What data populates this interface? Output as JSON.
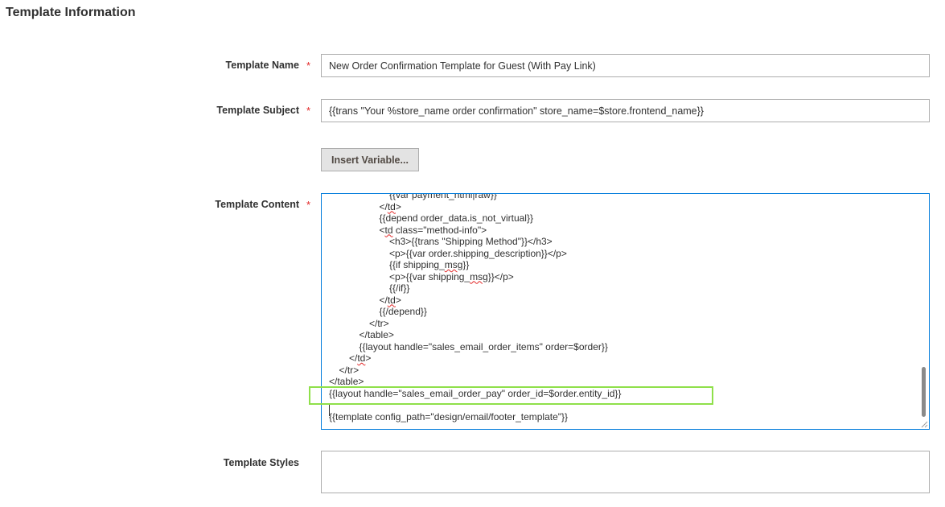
{
  "section": {
    "title": "Template Information"
  },
  "required_marker": "*",
  "fields": {
    "template_name": {
      "label": "Template Name",
      "value": "New Order Confirmation Template for Guest (With Pay Link)"
    },
    "template_subject": {
      "label": "Template Subject",
      "value": "{{trans \"Your %store_name order confirmation\" store_name=$store.frontend_name}}"
    },
    "insert_variable": {
      "label": "Insert Variable..."
    },
    "template_content": {
      "label": "Template Content",
      "lines": [
        {
          "text": "{{var payment_html|raw}}",
          "indent": 6
        },
        {
          "text": "</td>",
          "indent": 5,
          "spell": "td"
        },
        {
          "text": "{{depend order_data.is_not_virtual}}",
          "indent": 5
        },
        {
          "text": "<td class=\"method-info\">",
          "indent": 5,
          "spell": "td"
        },
        {
          "text": "<h3>{{trans \"Shipping Method\"}}</h3>",
          "indent": 6
        },
        {
          "text": "<p>{{var order.shipping_description}}</p>",
          "indent": 6
        },
        {
          "text": "{{if shipping_msg}}",
          "indent": 6,
          "spell": "msg"
        },
        {
          "text": "<p>{{var shipping_msg}}</p>",
          "indent": 6,
          "spell": "msg"
        },
        {
          "text": "{{/if}}",
          "indent": 6
        },
        {
          "text": "</td>",
          "indent": 5,
          "spell": "td"
        },
        {
          "text": "{{/depend}}",
          "indent": 5
        },
        {
          "text": "</tr>",
          "indent": 4
        },
        {
          "text": "</table>",
          "indent": 3
        },
        {
          "text": "{{layout handle=\"sales_email_order_items\" order=$order}}",
          "indent": 3
        },
        {
          "text": "</td>",
          "indent": 2,
          "spell": "td"
        },
        {
          "text": "</tr>",
          "indent": 1
        },
        {
          "text": "</table>",
          "indent": 0
        },
        {
          "text": "{{layout handle=\"sales_email_order_pay\" order_id=$order.entity_id}}",
          "indent": 0
        },
        {
          "text": "",
          "indent": 0
        },
        {
          "text": "{{template config_path=\"design/email/footer_template\"}}",
          "indent": 0
        }
      ]
    },
    "template_styles": {
      "label": "Template Styles",
      "value": ""
    }
  },
  "colors": {
    "required": "#e22626",
    "focus_border": "#007bdb",
    "highlight": "#8fe04a"
  },
  "icons": {
    "resize": "resize-grip-icon"
  }
}
